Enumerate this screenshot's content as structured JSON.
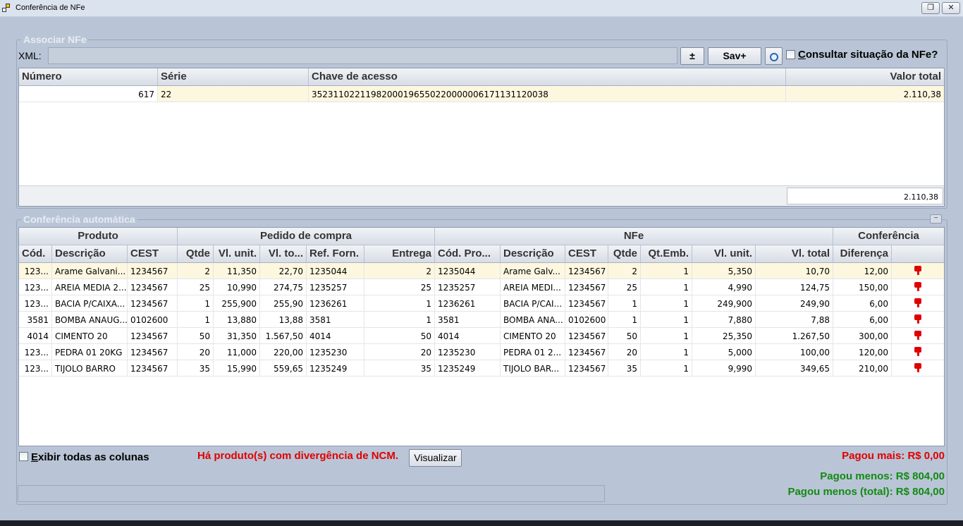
{
  "window": {
    "title": "Conferência de NFe"
  },
  "associar": {
    "legend": "Associar NFe",
    "xml_label": "XML:",
    "xml_value": "",
    "plus_minus_label": "±",
    "sav_label": "Sav+",
    "consult_label_first": "C",
    "consult_label_rest": "onsultar situação da NFe?",
    "columns": [
      "Número",
      "Série",
      "Chave de acesso",
      "Valor total"
    ],
    "rows": [
      {
        "numero": "617",
        "serie": "22",
        "chave": "35231102211982000196550220000006171131120038",
        "valor": "2.110,38"
      }
    ],
    "total": "2.110,38"
  },
  "conferencia": {
    "legend": "Conferência automática",
    "collapse_label": "−",
    "bands": [
      "Produto",
      "Pedido de compra",
      "NFe",
      "Conferência"
    ],
    "columns": [
      "Cód.",
      "Descrição",
      "CEST",
      "Qtde",
      "Vl. unit.",
      "Vl. to...",
      "Ref. Forn.",
      "Entrega",
      "Cód. Pro...",
      "Descrição",
      "CEST",
      "Qtde",
      "Qt.Emb.",
      "Vl. unit.",
      "Vl. total",
      "Diferença",
      ""
    ],
    "rows": [
      [
        "123...",
        "Arame Galvani...",
        "1234567",
        "2",
        "11,350",
        "22,70",
        "1235044",
        "2",
        "1235044",
        "Arame Galv...",
        "1234567",
        "2",
        "1",
        "5,350",
        "10,70",
        "12,00"
      ],
      [
        "123...",
        "AREIA MEDIA 2...",
        "1234567",
        "25",
        "10,990",
        "274,75",
        "1235257",
        "25",
        "1235257",
        "AREIA MEDI...",
        "1234567",
        "25",
        "1",
        "4,990",
        "124,75",
        "150,00"
      ],
      [
        "123...",
        "BACIA P/CAIXA...",
        "1234567",
        "1",
        "255,900",
        "255,90",
        "1236261",
        "1",
        "1236261",
        "BACIA P/CAI...",
        "1234567",
        "1",
        "1",
        "249,900",
        "249,90",
        "6,00"
      ],
      [
        "3581",
        "BOMBA ANAUG...",
        "0102600",
        "1",
        "13,880",
        "13,88",
        "3581",
        "1",
        "3581",
        "BOMBA ANA...",
        "0102600",
        "1",
        "1",
        "7,880",
        "7,88",
        "6,00"
      ],
      [
        "4014",
        "CIMENTO 20",
        "1234567",
        "50",
        "31,350",
        "1.567,50",
        "4014",
        "50",
        "4014",
        "CIMENTO 20",
        "1234567",
        "50",
        "1",
        "25,350",
        "1.267,50",
        "300,00"
      ],
      [
        "123...",
        "PEDRA 01 20KG",
        "1234567",
        "20",
        "11,000",
        "220,00",
        "1235230",
        "20",
        "1235230",
        "PEDRA 01 2...",
        "1234567",
        "20",
        "1",
        "5,000",
        "100,00",
        "120,00"
      ],
      [
        "123...",
        "TIJOLO BARRO",
        "1234567",
        "35",
        "15,990",
        "559,65",
        "1235249",
        "35",
        "1235249",
        "TIJOLO BAR...",
        "1234567",
        "35",
        "1",
        "9,990",
        "349,65",
        "210,00"
      ]
    ],
    "status_icon": "thumbs-down-icon",
    "status_color": "#e00000",
    "exibir_first": "E",
    "exibir_rest": "xibir todas as colunas",
    "ncm_message": "Há produto(s) com divergência de NCM.",
    "visualizar_label": "Visualizar",
    "pagou_mais": "Pagou mais: R$ 0,00",
    "pagou_menos": "Pagou menos: R$ 804,00",
    "pagou_menos_total": "Pagou menos (total): R$ 804,00"
  }
}
